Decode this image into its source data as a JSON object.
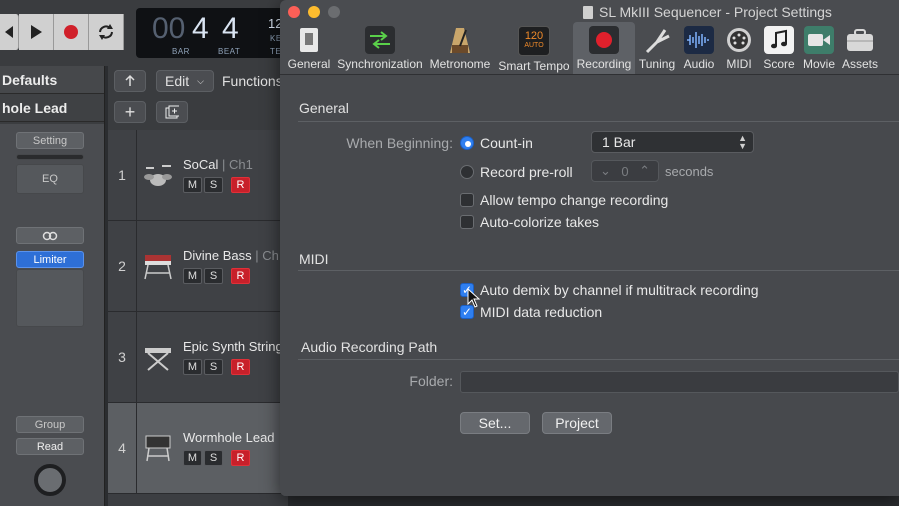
{
  "daw": {
    "lcd": {
      "bar_dim": "00",
      "bar": "4",
      "beat": "4",
      "bar_caption": "BAR",
      "beat_caption": "BEAT",
      "extra_top": "12",
      "extra_cap1": "KE",
      "extra_cap2": "TE"
    },
    "inspector": {
      "region": "Defaults",
      "track": "hole Lead",
      "setting_label": "Setting",
      "eq_label": "EQ",
      "link_icon": "link-icon",
      "plugin": "Limiter",
      "group_label": "Group",
      "read_label": "Read"
    },
    "header": {
      "edit_label": "Edit",
      "functions_label": "Functions"
    },
    "tracks": [
      {
        "num": "1",
        "name": "SoCal",
        "ch": " | Ch1",
        "icon": "drum-kit-icon"
      },
      {
        "num": "2",
        "name": "Divine Bass",
        "ch": " | Ch",
        "icon": "keyboard-icon"
      },
      {
        "num": "3",
        "name": "Epic Synth String",
        "ch": "",
        "icon": "keyboard-stand-icon"
      },
      {
        "num": "4",
        "name": "Wormhole Lead",
        "ch": "",
        "icon": "synth-icon"
      }
    ],
    "track_buttons": {
      "mute": "M",
      "solo": "S",
      "record": "R"
    }
  },
  "window": {
    "title": "SL MkIII Sequencer - Project Settings",
    "tabs": [
      {
        "label": "General",
        "icon": "general-icon"
      },
      {
        "label": "Synchronization",
        "icon": "synchronization-icon"
      },
      {
        "label": "Metronome",
        "icon": "metronome-icon"
      },
      {
        "label": "Smart Tempo",
        "icon": "smart-tempo-icon",
        "icon_text": "120",
        "icon_sub": "AUTO"
      },
      {
        "label": "Recording",
        "icon": "recording-icon",
        "active": true
      },
      {
        "label": "Tuning",
        "icon": "tuning-fork-icon"
      },
      {
        "label": "Audio",
        "icon": "audio-waveform-icon"
      },
      {
        "label": "MIDI",
        "icon": "midi-port-icon"
      },
      {
        "label": "Score",
        "icon": "score-icon"
      },
      {
        "label": "Movie",
        "icon": "movie-camera-icon"
      },
      {
        "label": "Assets",
        "icon": "assets-briefcase-icon"
      }
    ],
    "general": {
      "heading": "General",
      "when_beginning_label": "When Beginning:",
      "count_in_label": "Count-in",
      "count_in_value": "1 Bar",
      "preroll_label": "Record pre-roll",
      "preroll_value": "0",
      "preroll_unit": "seconds",
      "allow_tempo_label": "Allow tempo change recording",
      "auto_colorize_label": "Auto-colorize takes"
    },
    "midi": {
      "heading": "MIDI",
      "auto_demix_label": "Auto demix by channel if multitrack recording",
      "data_reduction_label": "MIDI data reduction"
    },
    "audio_path": {
      "heading": "Audio Recording Path",
      "folder_label": "Folder:",
      "folder_value": "",
      "set_button": "Set...",
      "project_button": "Project"
    }
  }
}
